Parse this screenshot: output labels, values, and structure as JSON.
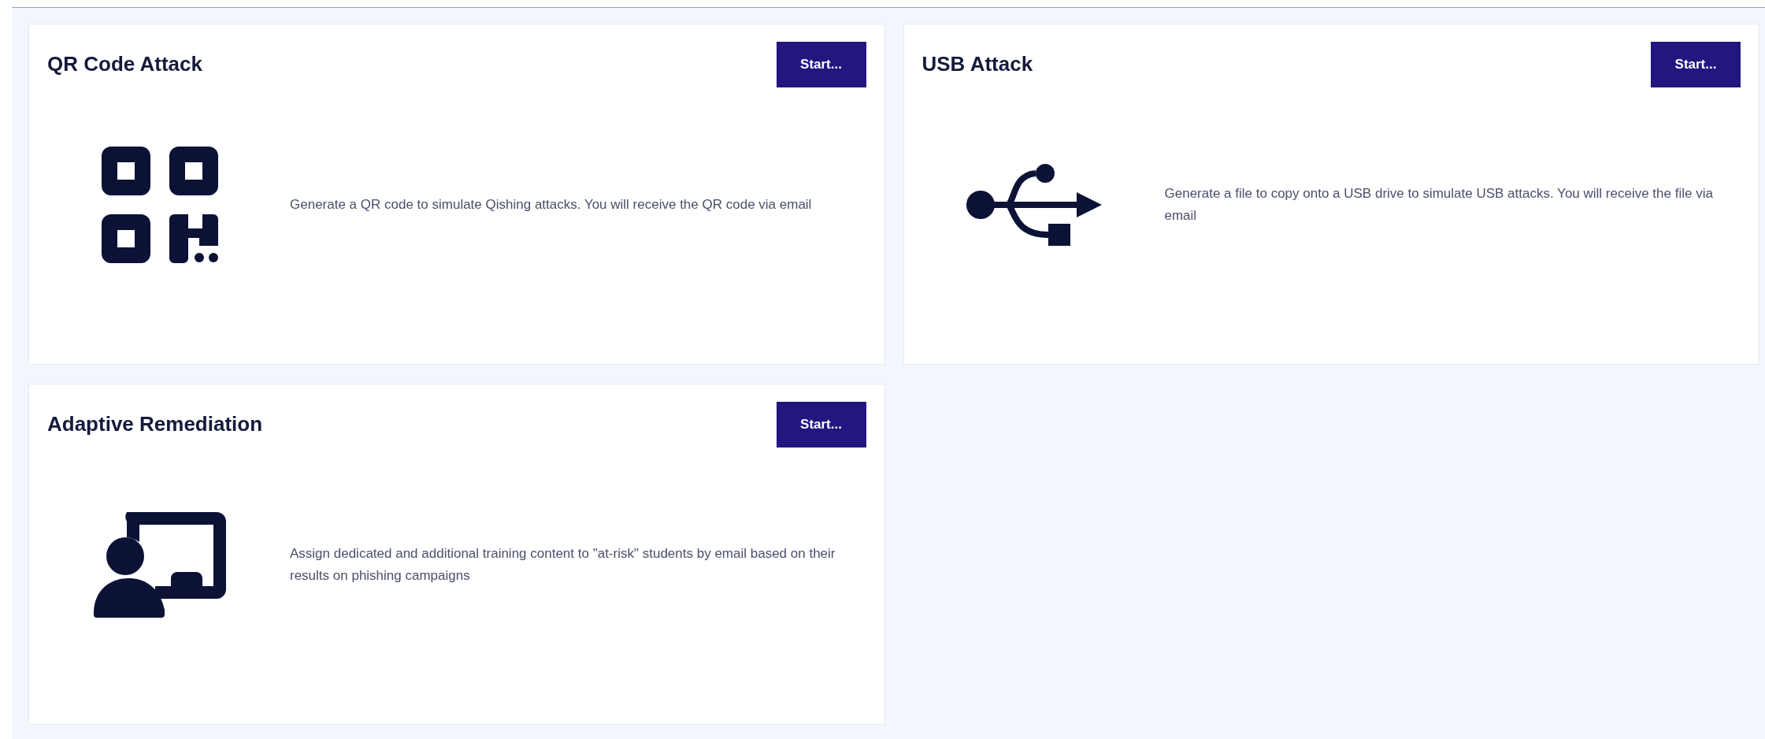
{
  "cards": [
    {
      "kind": "qr",
      "title": "QR Code Attack",
      "button": "Start...",
      "description": "Generate a QR code to simulate Qishing attacks. You will receive the QR code via email"
    },
    {
      "kind": "usb",
      "title": "USB Attack",
      "button": "Start...",
      "description": "Generate a file to copy onto a USB drive to simulate USB attacks. You will receive the file via email"
    },
    {
      "kind": "remediation",
      "title": "Adaptive Remediation",
      "button": "Start...",
      "description": "Assign dedicated and additional training content to \"at-risk\" students by email based on their results on phishing campaigns"
    }
  ]
}
